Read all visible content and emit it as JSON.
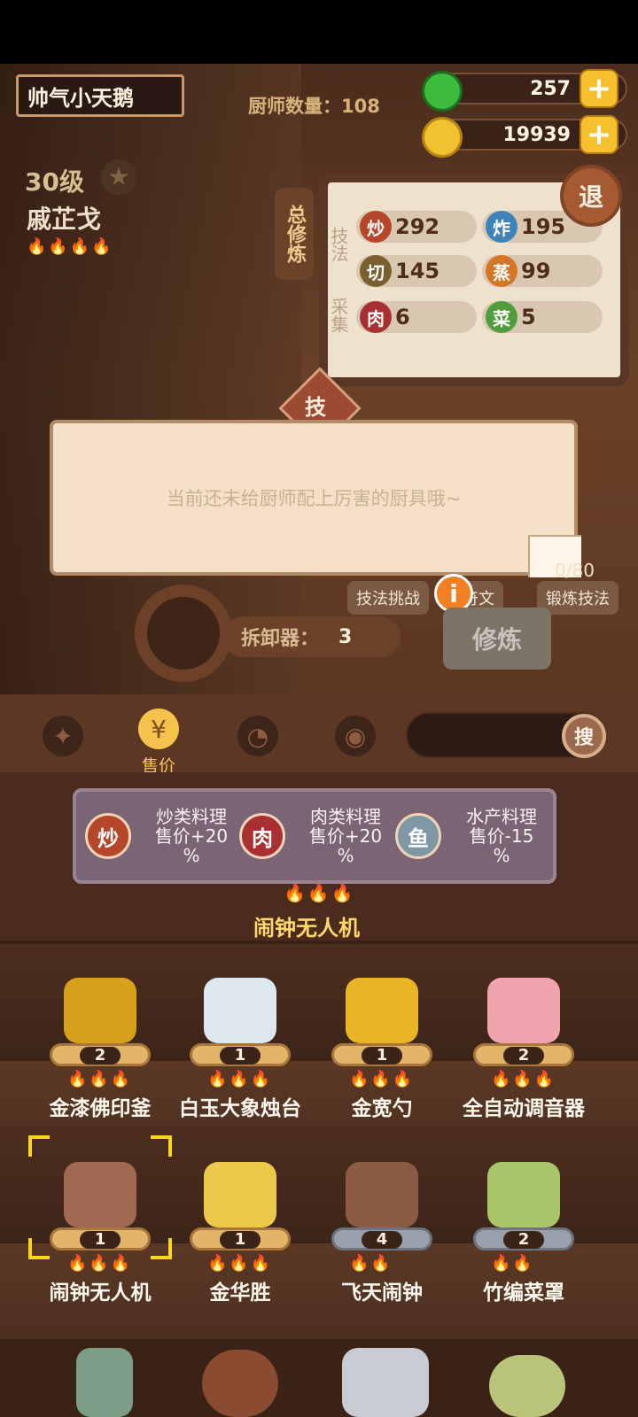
{
  "header": {
    "player_name": "帅气小天鹅",
    "chef_count": "厨师数量：108",
    "jade": "257",
    "coins": "19939"
  },
  "chef": {
    "level": "30级",
    "name": "戚芷戈"
  },
  "training_panel": {
    "title": "总修炼",
    "tech_label": "技法",
    "collect_label": "采集",
    "exit_label": "退",
    "skills": [
      {
        "icon": "炒",
        "value": "292",
        "color": "#b54629"
      },
      {
        "icon": "炸",
        "value": "195",
        "color": "#3e83b7"
      },
      {
        "icon": "切",
        "value": "145",
        "color": "#7a5f2f"
      },
      {
        "icon": "蒸",
        "value": "99",
        "color": "#d57627"
      },
      {
        "icon": "肉",
        "value": "6",
        "color": "#a93032"
      },
      {
        "icon": "菜",
        "value": "5",
        "color": "#4f9d3d"
      }
    ],
    "skill_badge": "技"
  },
  "dialog": {
    "message": "当前还未给厨师配上厉害的厨具哦~"
  },
  "actions": {
    "technique_challenge": "技法挑战",
    "rune_text": "符文",
    "progress": "0/80",
    "forge_technique": "锻炼技法",
    "remove_label": "拆卸器：",
    "remove_count": "3",
    "train_button": "修炼"
  },
  "filters": {
    "active_label": "售价",
    "search_button": "搜"
  },
  "bonuses": [
    {
      "icon": "炒",
      "line1": "炒类料理",
      "line2": "售价+20",
      "line3": "%"
    },
    {
      "icon": "肉",
      "line1": "肉类料理",
      "line2": "售价+20",
      "line3": "%"
    },
    {
      "icon": "鱼",
      "line1": "水产料理",
      "line2": "售价-15",
      "line3": "%"
    }
  ],
  "equipped_item": {
    "name": "闹钟无人机"
  },
  "items": [
    {
      "name": "金漆佛印釜",
      "count": "2"
    },
    {
      "name": "白玉大象烛台",
      "count": "1"
    },
    {
      "name": "金宽勺",
      "count": "1"
    },
    {
      "name": "全自动调音器",
      "count": "2"
    },
    {
      "name": "闹钟无人机",
      "count": "1"
    },
    {
      "name": "金华胜",
      "count": "1"
    },
    {
      "name": "飞天闹钟",
      "count": "4"
    },
    {
      "name": "竹编菜罩",
      "count": "2"
    }
  ]
}
